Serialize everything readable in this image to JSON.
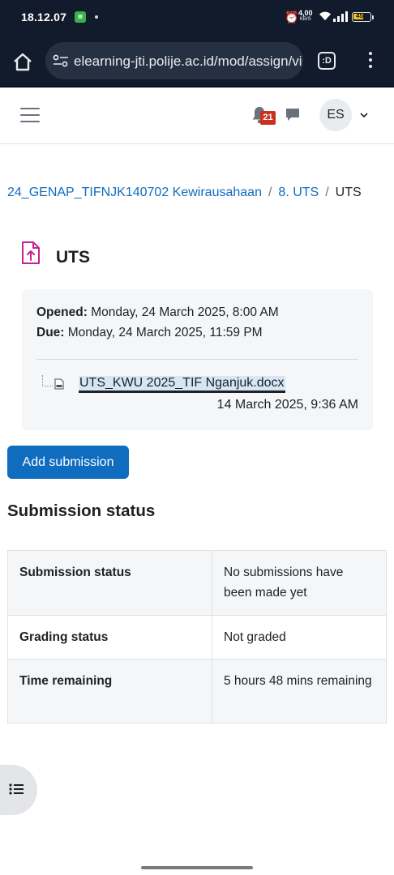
{
  "status_bar": {
    "time": "18.12.07",
    "net_speed_value": "4,00",
    "net_speed_unit": "KB/S",
    "battery": "45"
  },
  "browser": {
    "url": "elearning-jti.polije.ac.id/mod/assign/vi"
  },
  "header": {
    "notification_count": "21",
    "user_initials": "ES"
  },
  "breadcrumb": {
    "course": "24_GENAP_TIFNJK140702 Kewirausahaan",
    "section": "8. UTS",
    "current": "UTS"
  },
  "page": {
    "title": "UTS"
  },
  "dates": {
    "opened_label": "Opened:",
    "opened_value": "Monday, 24 March 2025, 8:00 AM",
    "due_label": "Due:",
    "due_value": "Monday, 24 March 2025, 11:59 PM"
  },
  "attachment": {
    "filename": "UTS_KWU 2025_TIF Nganjuk.docx",
    "modified": "14 March 2025, 9:36 AM"
  },
  "actions": {
    "add_submission": "Add submission"
  },
  "submission": {
    "heading": "Submission status",
    "rows": [
      {
        "label": "Submission status",
        "value": "No submissions have been made yet"
      },
      {
        "label": "Grading status",
        "value": "Not graded"
      },
      {
        "label": "Time remaining",
        "value": "5 hours 48 mins remaining"
      }
    ]
  },
  "colors": {
    "primary": "#0f6cbf",
    "notification_badge": "#ca3120",
    "assignment_icon": "#c5238d",
    "browser_chrome": "#121b2b"
  }
}
